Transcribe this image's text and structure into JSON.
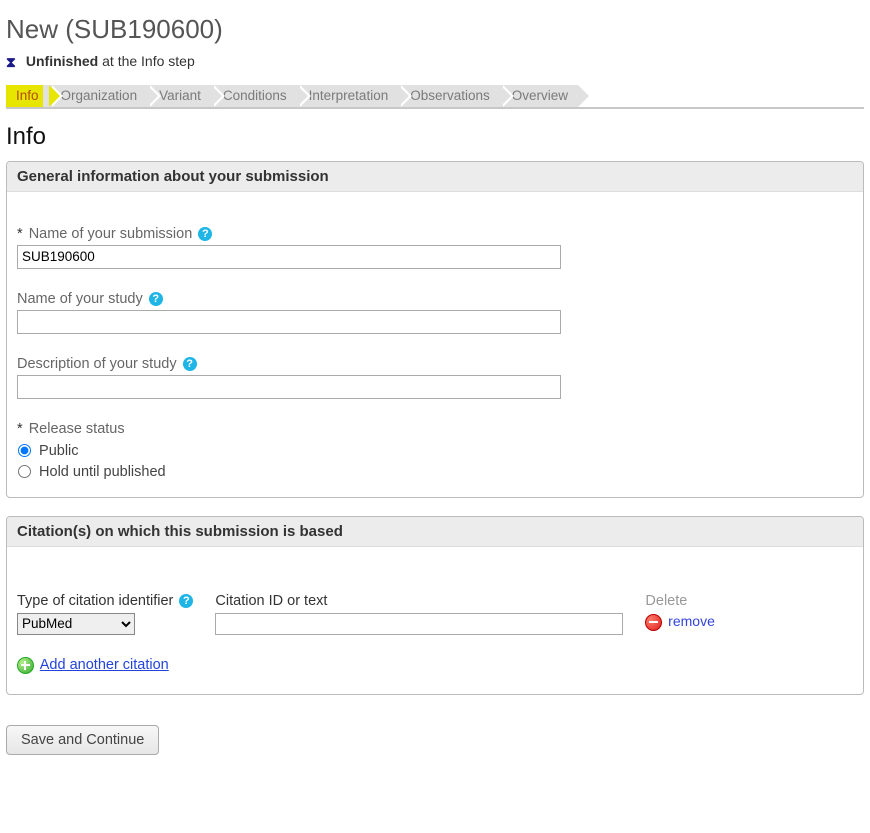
{
  "page_title": "New (SUB190600)",
  "status": {
    "bold": "Unfinished",
    "rest": " at the Info step"
  },
  "tabs": [
    "Info",
    "Organization",
    "Variant",
    "Conditions",
    "Interpretation",
    "Observations",
    "Overview"
  ],
  "active_tab_index": 0,
  "section_heading": "Info",
  "box1": {
    "header": "General information about your submission",
    "name_label": "Name of your submission",
    "name_value": "SUB190600",
    "study_label": "Name of your study",
    "study_value": "",
    "desc_label": "Description of your study",
    "desc_value": "",
    "release_label": "Release status",
    "release_options": [
      "Public",
      "Hold until published"
    ],
    "release_selected_index": 0
  },
  "box2": {
    "header": "Citation(s) on which this submission is based",
    "type_label": "Type of citation identifier",
    "type_value": "PubMed",
    "citid_label": "Citation ID or text",
    "citid_value": "",
    "delete_label": "Delete",
    "remove_text": "remove",
    "add_text": "Add another citation"
  },
  "save_label": "Save and Continue"
}
